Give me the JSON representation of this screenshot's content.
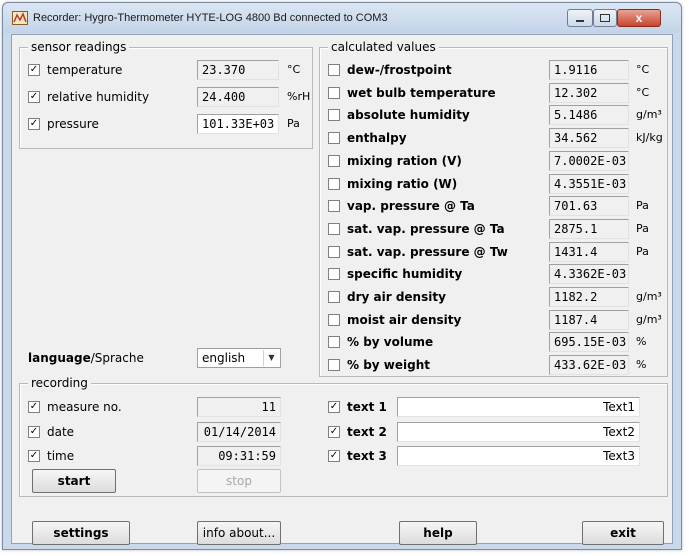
{
  "window": {
    "title": "Recorder: Hygro-Thermometer HYTE-LOG 4800 Bd connected to COM3",
    "close_label": "x",
    "icon": "app-icon"
  },
  "sensor": {
    "group_label": "sensor readings",
    "rows": [
      {
        "checked": "✓",
        "label": "temperature",
        "value": "23.370",
        "unit": "°C"
      },
      {
        "checked": "✓",
        "label": "relative humidity",
        "value": "24.400",
        "unit": "%rH"
      },
      {
        "checked": "✓",
        "label": "pressure",
        "value": "101.33E+03",
        "unit": "Pa"
      }
    ]
  },
  "calc": {
    "group_label": "calculated values",
    "rows": [
      {
        "label": "dew-/frostpoint",
        "value": "1.9116",
        "unit": "°C"
      },
      {
        "label": "wet bulb temperature",
        "value": "12.302",
        "unit": "°C"
      },
      {
        "label": "absolute humidity",
        "value": "5.1486",
        "unit": "g/m³"
      },
      {
        "label": "enthalpy",
        "value": "34.562",
        "unit": "kJ/kg"
      },
      {
        "label": "mixing ration (V)",
        "value": "7.0002E-03",
        "unit": ""
      },
      {
        "label": "mixing ratio (W)",
        "value": "4.3551E-03",
        "unit": ""
      },
      {
        "label": "vap. pressure @ Ta",
        "value": "701.63",
        "unit": "Pa"
      },
      {
        "label": "sat. vap. pressure @ Ta",
        "value": "2875.1",
        "unit": "Pa"
      },
      {
        "label": "sat. vap. pressure @ Tw",
        "value": "1431.4",
        "unit": "Pa"
      },
      {
        "label": "specific humidity",
        "value": "4.3362E-03",
        "unit": ""
      },
      {
        "label": "dry air density",
        "value": "1182.2",
        "unit": "g/m³"
      },
      {
        "label": "moist air density",
        "value": "1187.4",
        "unit": "g/m³"
      },
      {
        "label": "% by volume",
        "value": "695.15E-03",
        "unit": "%"
      },
      {
        "label": "% by weight",
        "value": "433.62E-03",
        "unit": "%"
      }
    ]
  },
  "language": {
    "label_bold": "language",
    "label_rest": "/Sprache",
    "selected": "english",
    "arrow": "▼"
  },
  "recording": {
    "group_label": "recording",
    "rows": [
      {
        "checked": "✓",
        "label": "measure no.",
        "value": "11"
      },
      {
        "checked": "✓",
        "label": "date",
        "value": "01/14/2014"
      },
      {
        "checked": "✓",
        "label": "time",
        "value": "09:31:59"
      }
    ],
    "texts": [
      {
        "checked": "✓",
        "label": "text 1",
        "value": "Text1"
      },
      {
        "checked": "✓",
        "label": "text 2",
        "value": "Text2"
      },
      {
        "checked": "✓",
        "label": "text 3",
        "value": "Text3"
      }
    ],
    "start_label": "start",
    "stop_label": "stop"
  },
  "bottom": {
    "settings_label": "settings",
    "info_label": "info about...",
    "help_label": "help",
    "exit_label": "exit"
  }
}
